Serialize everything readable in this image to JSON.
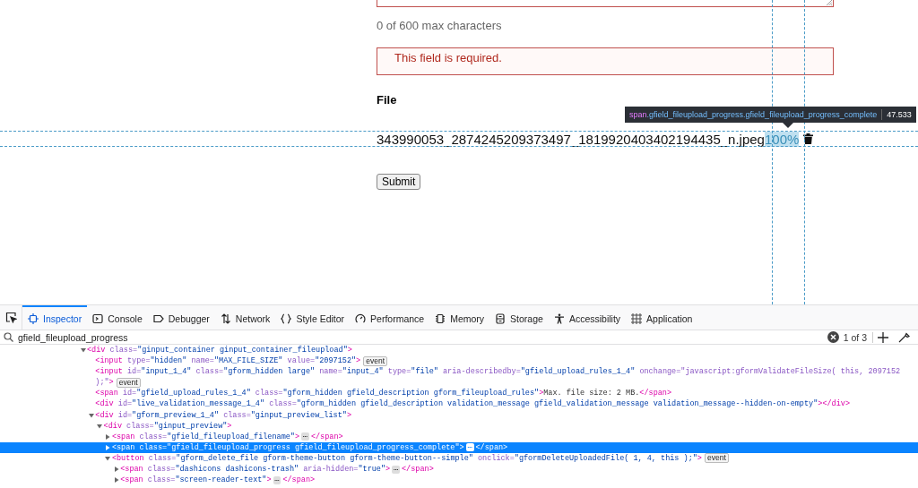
{
  "form": {
    "char_count": "0 of 600 max characters",
    "error": "This field is required.",
    "file_label": "File",
    "filename": "343990053_2874245209373497_1819920403402194435_n.jpeg",
    "progress": "100%",
    "highlighted": true,
    "submit": "Submit"
  },
  "tooltip": {
    "selector": "span.gfield_fileupload_progress.gfield_fileupload_progress_complete",
    "size": "47.533"
  },
  "devtools": {
    "tabs": [
      {
        "label": "Inspector",
        "kind": "inspector",
        "selected": true
      },
      {
        "label": "Console",
        "kind": "console",
        "selected": false
      },
      {
        "label": "Debugger",
        "kind": "debugger",
        "selected": false
      },
      {
        "label": "Network",
        "kind": "network",
        "selected": false
      },
      {
        "label": "Style Editor",
        "kind": "style",
        "selected": false
      },
      {
        "label": "Performance",
        "kind": "performance",
        "selected": false
      },
      {
        "label": "Memory",
        "kind": "memory",
        "selected": false
      },
      {
        "label": "Storage",
        "kind": "storage",
        "selected": false
      },
      {
        "label": "Accessibility",
        "kind": "accessibility",
        "selected": false
      },
      {
        "label": "Application",
        "kind": "application",
        "selected": false
      }
    ],
    "search": {
      "value": "gfield_fileupload_progress",
      "matches": "1 of 3"
    },
    "tree": [
      {
        "text": "<div class=\"ginput_container ginput_container_fileupload\">",
        "expanded": true,
        "selected": false,
        "children": [
          {
            "text": "<input type=\"hidden\" name=\"MAX_FILE_SIZE\" value=\"2097152\">",
            "badge": "event",
            "selected": false
          },
          {
            "text": "<input id=\"input_1_4\" class=\"gform_hidden large\" name=\"input_4\" type=\"file\" aria-describedby=\"gfield_upload_rules_1_4\" onchange=\"javascript:gformValidateFileSize( this, 2097152",
            "continued": ");\">",
            "badge": "event",
            "selected": false
          },
          {
            "text": "<span id=\"gfield_upload_rules_1_4\" class=\"gform_hidden gfield_description gform_fileupload_rules\">Max. file size: 2 MB.</span>",
            "selected": false
          },
          {
            "text": "<div id=\"live_validation_message_1_4\" class=\"gform_hidden gfield_description validation_message gfield_validation_message validation_message--hidden-on-empty\"></div>",
            "selected": false
          },
          {
            "text": "<div id=\"gform_preview_1_4\" class=\"ginput_preview_list\">",
            "expanded": true,
            "selected": false,
            "children": [
              {
                "text": "<div class=\"ginput_preview\">",
                "expanded": true,
                "selected": false,
                "children": [
                  {
                    "text": "<span class=\"gfield_fileupload_filename\">",
                    "ellipsis": "⋯",
                    "close": "</span>",
                    "expanded": false,
                    "selected": false
                  },
                  {
                    "text": "<span class=\"gfield_fileupload_progress gfield_fileupload_progress_complete\">",
                    "ellipsis": "⋯",
                    "close": "</span>",
                    "expanded": false,
                    "selected": true
                  },
                  {
                    "text": "<button class=\"gform_delete_file gform-theme-button gform-theme-button--simple\" onclick=\"gformDeleteUploadedFile( 1, 4, this );\">",
                    "badge": "event",
                    "expanded": true,
                    "selected": false,
                    "children": [
                      {
                        "text": "<span class=\"dashicons dashicons-trash\" aria-hidden=\"true\">",
                        "ellipsis": "⋯",
                        "close": "</span>",
                        "expanded": false,
                        "selected": false
                      },
                      {
                        "text": "<span class=\"screen-reader-text\">",
                        "ellipsis": "⋯",
                        "close": "</span>",
                        "expanded": false,
                        "selected": false
                      }
                    ]
                  }
                ]
              }
            ]
          }
        ]
      }
    ]
  }
}
